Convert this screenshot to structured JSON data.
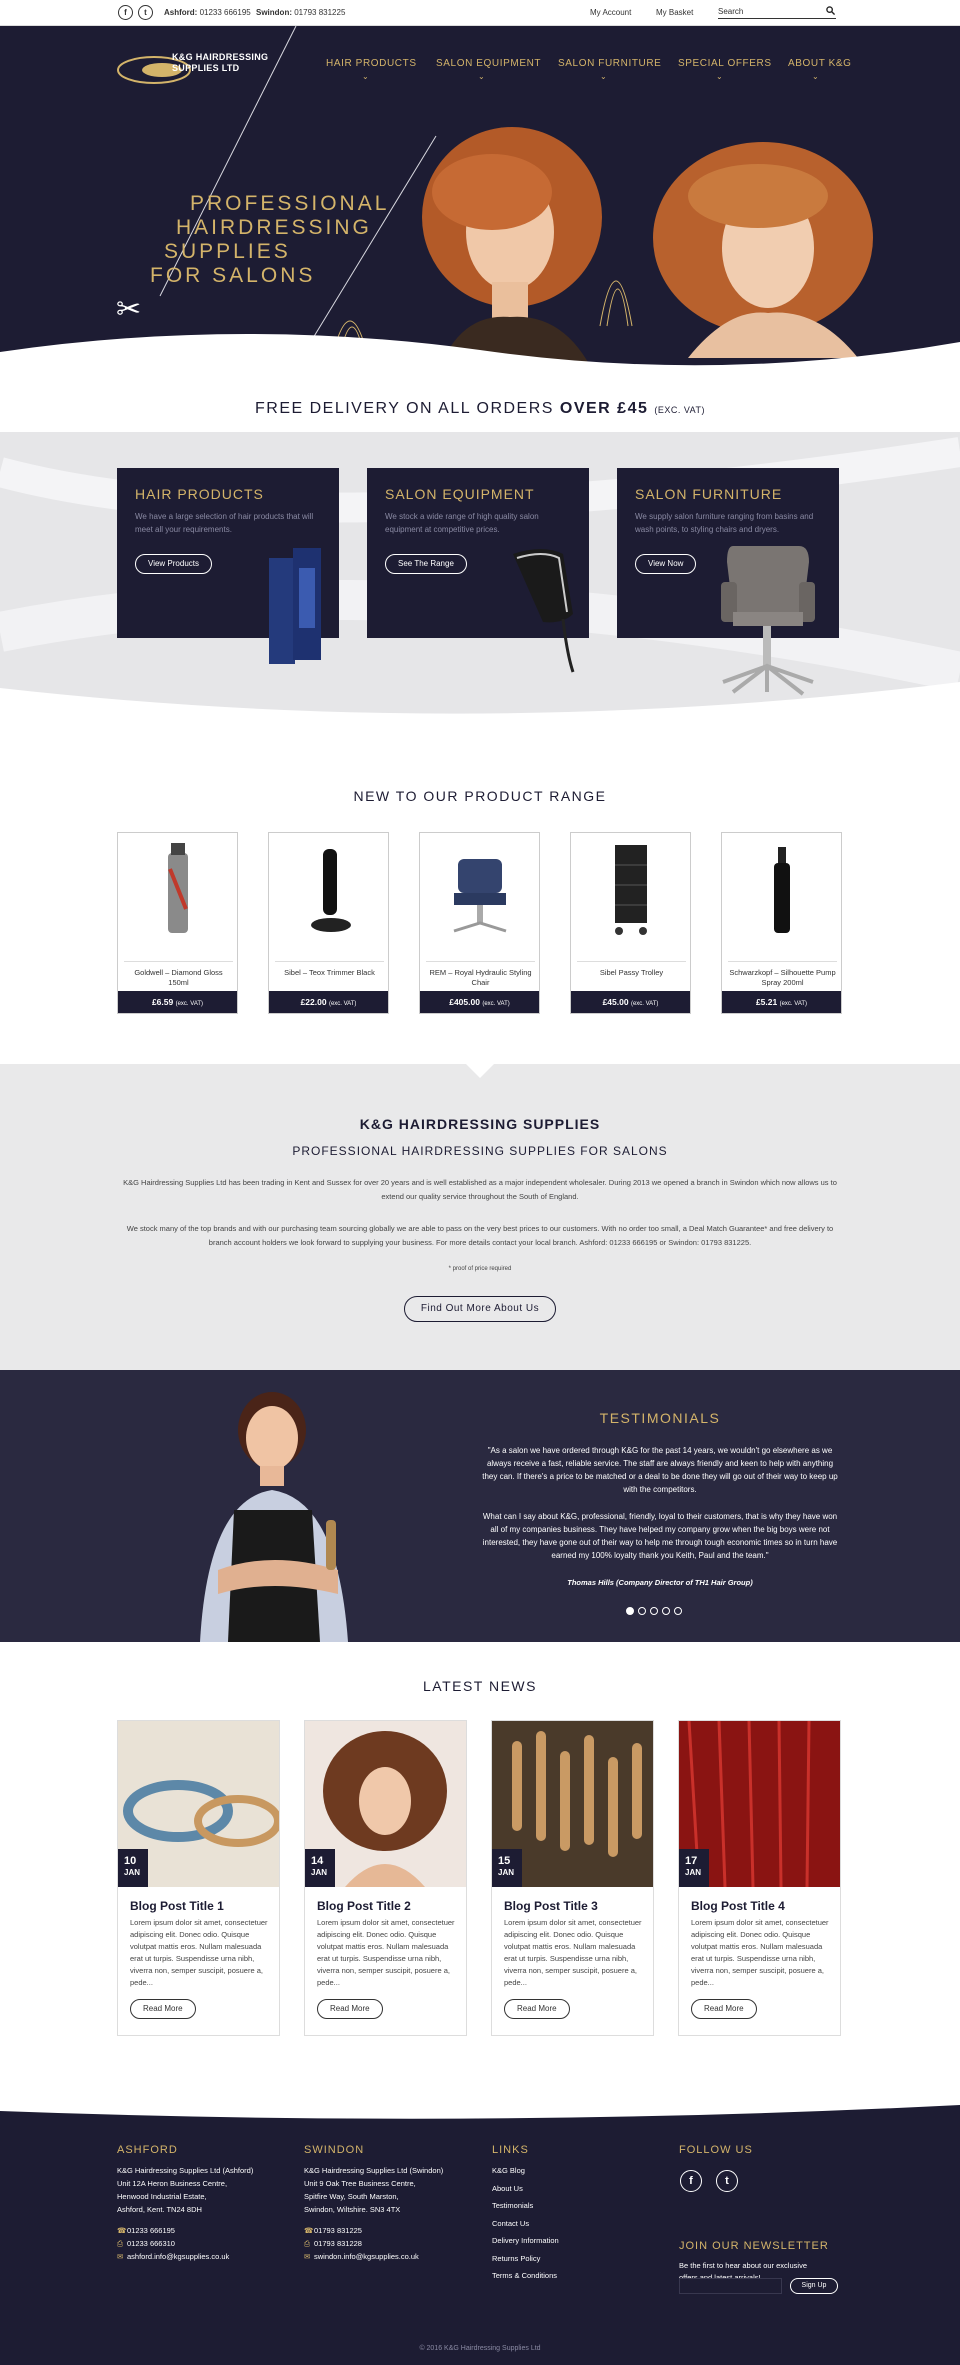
{
  "topbar": {
    "facebook_icon": "f",
    "twitter_icon": "t",
    "ashford_label": "Ashford:",
    "ashford_phone": "01233 666195",
    "swindon_label": "Swindon:",
    "swindon_phone": "01793 831225",
    "my_account": "My Account",
    "my_basket": "My Basket",
    "search_placeholder": "Search"
  },
  "hero": {
    "logo_line1": "K&G HAIRDRESSING",
    "logo_line2": "SUPPLIES LTD",
    "nav": [
      "HAIR PRODUCTS",
      "SALON EQUIPMENT",
      "SALON FURNITURE",
      "SPECIAL OFFERS",
      "ABOUT K&G"
    ],
    "headline": [
      "PROFESSIONAL",
      "HAIRDRESSING",
      "SUPPLIES",
      "FOR SALONS"
    ],
    "colors": {
      "navy": "#1d1c33",
      "gold": "#d4b46a"
    }
  },
  "delivery": {
    "text": "FREE DELIVERY ON ALL ORDERS ",
    "bold": "OVER £45",
    "small": "(EXC. VAT)"
  },
  "categories": [
    {
      "title": "HAIR PRODUCTS",
      "desc": "We have a large selection of hair products that will meet all your requirements.",
      "button": "View Products"
    },
    {
      "title": "SALON EQUIPMENT",
      "desc": "We stock a wide range of high quality salon equipment at competitive prices.",
      "button": "See The Range"
    },
    {
      "title": "SALON FURNITURE",
      "desc": "We supply salon furniture ranging from basins and wash points, to styling chairs and dryers.",
      "button": "View Now"
    }
  ],
  "range": {
    "title": "NEW TO OUR PRODUCT RANGE",
    "vat": "(exc. VAT)",
    "products": [
      {
        "name": "Goldwell – Diamond Gloss 150ml",
        "price": "£6.59"
      },
      {
        "name": "Sibel – Teox Trimmer Black",
        "price": "£22.00"
      },
      {
        "name": "REM – Royal Hydraulic Styling Chair",
        "price": "£405.00"
      },
      {
        "name": "Sibel Passy Trolley",
        "price": "£45.00"
      },
      {
        "name": "Schwarzkopf – Silhouette Pump Spray 200ml",
        "price": "£5.21"
      }
    ]
  },
  "about": {
    "title": "K&G HAIRDRESSING SUPPLIES",
    "subtitle": "PROFESSIONAL HAIRDRESSING SUPPLIES FOR SALONS",
    "p1": "K&G Hairdressing Supplies Ltd has been trading in Kent and Sussex for over 20 years and is well established as a major independent wholesaler. During 2013 we opened a branch in Swindon which now allows us to extend our quality service throughout the South of England.",
    "p2": "We stock many of the top brands and with our purchasing team sourcing globally we are able to pass on the very best prices to our customers. With no order too small, a Deal Match Guarantee* and free delivery to branch account holders we look forward to supplying your business. For more details contact your local branch. Ashford: 01233 666195 or Swindon: 01793 831225.",
    "note": "* proof of price required",
    "button": "Find Out More About Us"
  },
  "testimonials": {
    "title": "TESTIMONIALS",
    "p1": "\"As a salon we have ordered through K&G for the past 14 years, we wouldn't go elsewhere as we always receive a fast, reliable service. The staff are always friendly and keen to help with anything they can. If there's a price to be matched or a deal to be done they will go out of their way to keep up with the competitors.",
    "p2": "What can I say about K&G, professional, friendly, loyal to their customers, that is why they have won all of my companies business. They have helped my company grow when the big boys were not interested, they have gone out of their way to help me through tough economic times so in turn have earned my 100% loyalty thank you Keith, Paul and the team.\"",
    "author": "Thomas Hills (Company Director of TH1 Hair Group)",
    "slide_count": 5,
    "active_slide": 1
  },
  "news": {
    "title": "LATEST NEWS",
    "read_more": "Read More",
    "excerpt": "Lorem ipsum dolor sit amet, consectetuer adipiscing elit. Donec odio. Quisque volutpat mattis eros. Nullam malesuada erat ut turpis. Suspendisse urna nibh, viverra non, semper suscipit, posuere a, pede...",
    "posts": [
      {
        "title": "Blog Post Title 1",
        "day": "10",
        "month": "JAN"
      },
      {
        "title": "Blog Post Title 2",
        "day": "14",
        "month": "JAN"
      },
      {
        "title": "Blog Post Title 3",
        "day": "15",
        "month": "JAN"
      },
      {
        "title": "Blog Post Title 4",
        "day": "17",
        "month": "JAN"
      }
    ]
  },
  "footer": {
    "ashford": {
      "title": "ASHFORD",
      "lines": [
        "K&G Hairdressing Supplies Ltd (Ashford)",
        "Unit 12A Heron Business Centre,",
        "Henwood Industrial Estate,",
        "Ashford, Kent. TN24 8DH"
      ],
      "phone": "01233 666195",
      "fax": "01233 666310",
      "email": "ashford.info@kgsupplies.co.uk"
    },
    "swindon": {
      "title": "SWINDON",
      "lines": [
        "K&G Hairdressing Supplies Ltd (Swindon)",
        "Unit 9 Oak Tree Business Centre,",
        "Spitfire Way, South Marston,",
        "Swindon, Wiltshire. SN3 4TX"
      ],
      "phone": "01793 831225",
      "fax": "01793 831228",
      "email": "swindon.info@kgsupplies.co.uk"
    },
    "links_title": "LINKS",
    "links": [
      "K&G Blog",
      "About Us",
      "Testimonials",
      "Contact Us",
      "Delivery Information",
      "Returns Policy",
      "Terms & Conditions"
    ],
    "follow_title": "FOLLOW US",
    "newsletter_title": "JOIN OUR NEWSLETTER",
    "newsletter_text": "Be the first to hear about our exclusive offers and latest arrivals!",
    "signup": "Sign Up",
    "copyright": "© 2016 K&G Hairdressing Supplies Ltd"
  }
}
